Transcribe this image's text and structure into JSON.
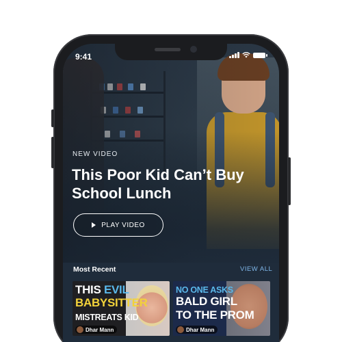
{
  "status_bar": {
    "time": "9:41"
  },
  "hero": {
    "eyebrow": "NEW VIDEO",
    "title": "This Poor Kid Can’t Buy School Lunch",
    "play_label": "PLAY VIDEO"
  },
  "most_recent": {
    "title": "Most Recent",
    "view_all_label": "VIEW ALL",
    "thumbnails": [
      {
        "line1_a": "THIS",
        "line1_b": "EVIL",
        "line2": "BABYSITTER",
        "line3": "MISTREATS KID",
        "brand": "Dhar Mann"
      },
      {
        "line1": "NO ONE ASKS",
        "line2": "BALD GIRL",
        "line3": "TO THE PROM",
        "brand": "Dhar Mann"
      }
    ]
  },
  "colors": {
    "accent": "#7fb6e8",
    "thumb_highlight": "#5ab8ea",
    "thumb_yellow": "#f2d23a"
  }
}
